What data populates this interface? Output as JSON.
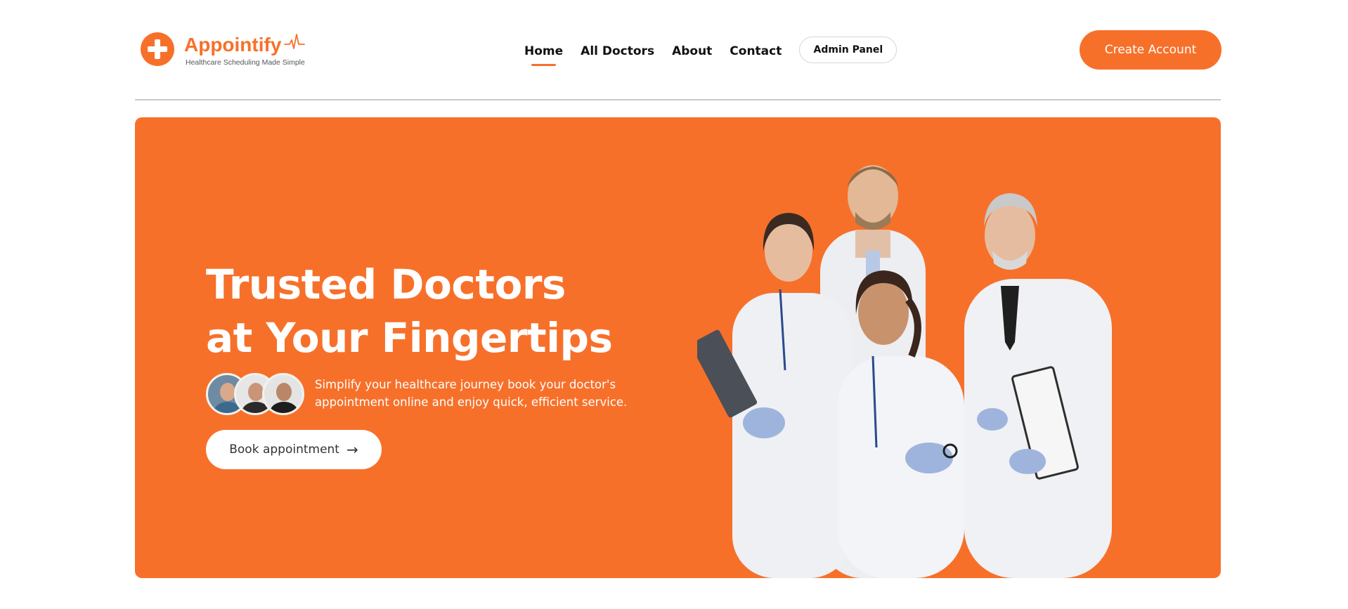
{
  "brand": {
    "name": "Appointify",
    "tagline": "Healthcare Scheduling Made Simple",
    "accent": "#f7702a"
  },
  "nav": {
    "links": [
      {
        "label": "Home",
        "active": true
      },
      {
        "label": "All Doctors",
        "active": false
      },
      {
        "label": "About",
        "active": false
      },
      {
        "label": "Contact",
        "active": false
      }
    ],
    "admin_label": "Admin Panel",
    "create_account_label": "Create Account"
  },
  "hero": {
    "title_line1": "Trusted Doctors",
    "title_line2": "at Your Fingertips",
    "subtitle": "Simplify your healthcare journey book your doctor's appointment online and enjoy quick, efficient service.",
    "cta_label": "Book appointment",
    "cta_icon": "arrow-right-icon",
    "background": "#f7702a"
  }
}
